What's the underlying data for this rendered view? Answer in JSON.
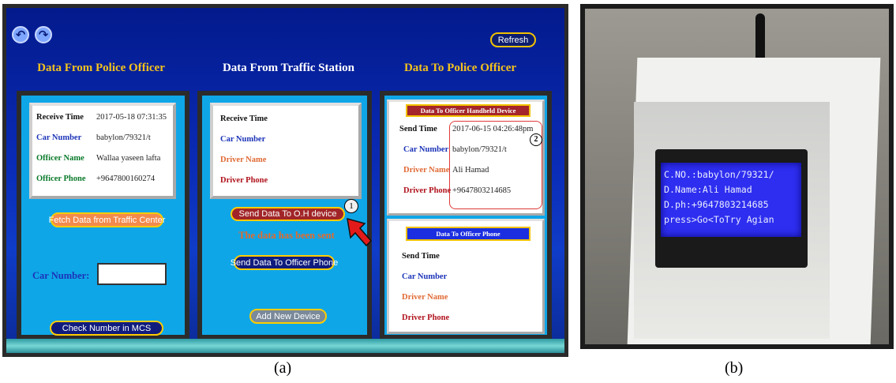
{
  "nav": {
    "back_icon": "undo-icon",
    "forward_icon": "redo-icon",
    "refresh_label": "Refresh"
  },
  "columns": {
    "police": {
      "title": "Data From Police Officer",
      "rows": [
        {
          "label": "Receive Time",
          "value": "2017-05-18 07:31:35"
        },
        {
          "label": "Car Number",
          "value": "babylon/79321/t"
        },
        {
          "label": "Officer Name",
          "value": "Wallaa yaseen lafta"
        },
        {
          "label": "Officer Phone",
          "value": "+9647800160274"
        }
      ],
      "fetch_label": "Fetch Data from Traffic Center",
      "car_number_label": "Car Number:",
      "car_number_value": "",
      "check_label": "Check Number in MCS"
    },
    "station": {
      "title": "Data From Traffic Station",
      "rows": [
        {
          "label": "Receive Time"
        },
        {
          "label": "Car Number"
        },
        {
          "label": "Driver Name"
        },
        {
          "label": "Driver Phone"
        }
      ],
      "send_oh_label": "Send Data To O.H device",
      "marker_1": "1",
      "status": "The data has been sent",
      "send_phone_label": "Send Data To Officer Phone",
      "add_device_label": "Add New Device"
    },
    "to_officer": {
      "title": "Data To Police Officer",
      "handheld": {
        "header": "Data To Officer Handheld Device",
        "rows": [
          {
            "label": "Send Time",
            "value": "2017-06-15 04:26:48pm"
          },
          {
            "label": "Car Number",
            "value": "babylon/79321/t"
          },
          {
            "label": "Driver Name",
            "value": "Ali Hamad"
          },
          {
            "label": "Driver Phone",
            "value": "+9647803214685"
          }
        ],
        "marker_2": "2"
      },
      "phone": {
        "header": "Data To Officer Phone",
        "rows": [
          {
            "label": "Send Time"
          },
          {
            "label": "Car Number"
          },
          {
            "label": "Driver Name"
          },
          {
            "label": "Driver Phone"
          }
        ]
      }
    }
  },
  "device_lcd": {
    "lines": [
      "C.NO.:babylon/79321/",
      "D.Name:Ali Hamad",
      "D.ph:+9647803214685",
      "press>Go<ToTry Agian"
    ]
  },
  "captions": {
    "a": "(a)",
    "b": "(b)"
  },
  "colors": {
    "accent_yellow": "#f3c21d",
    "panel_cyan": "#0fa6e8",
    "lcd_blue": "#2e2ef0"
  }
}
